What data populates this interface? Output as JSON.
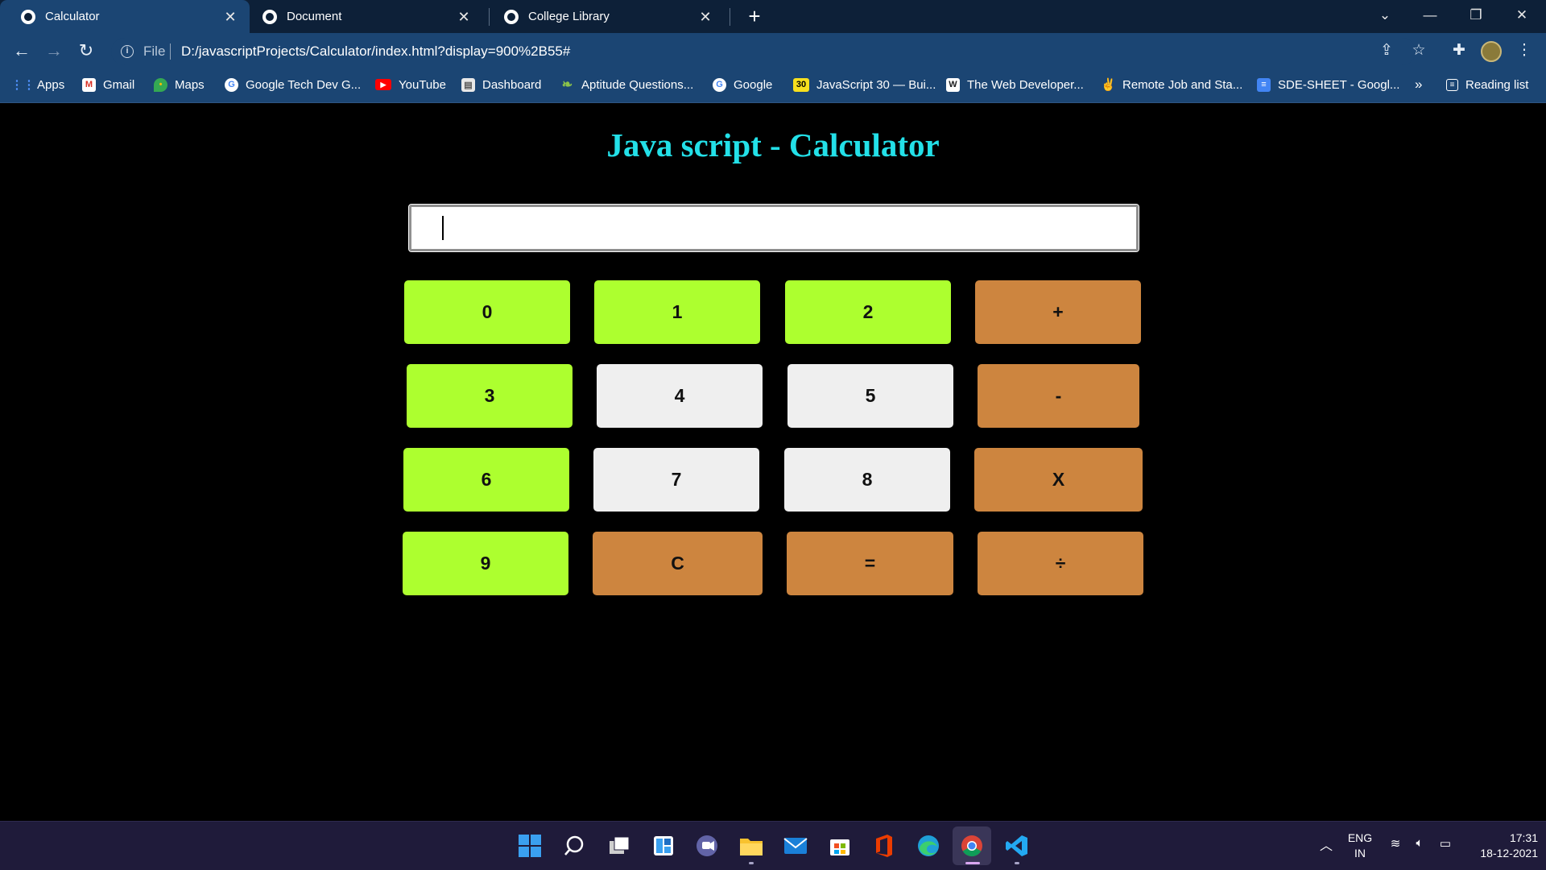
{
  "browser": {
    "tabs": [
      {
        "label": "Calculator",
        "active": true
      },
      {
        "label": "Document",
        "active": false
      },
      {
        "label": "College Library",
        "active": false
      }
    ],
    "url_scheme": "File",
    "url": "D:/javascriptProjects/Calculator/index.html?display=900%2B55#",
    "bookmarks": [
      {
        "label": "Apps",
        "icon": "apps-grid-icon"
      },
      {
        "label": "Gmail",
        "icon": "gmail-icon"
      },
      {
        "label": "Maps",
        "icon": "maps-icon"
      },
      {
        "label": "Google Tech Dev G...",
        "icon": "google-icon"
      },
      {
        "label": "YouTube",
        "icon": "youtube-icon"
      },
      {
        "label": "Dashboard",
        "icon": "dashboard-icon"
      },
      {
        "label": "Aptitude Questions...",
        "icon": "leaf-icon"
      },
      {
        "label": "Google",
        "icon": "google-icon"
      },
      {
        "label": "JavaScript 30 — Bui...",
        "icon": "js30-icon"
      },
      {
        "label": "The Web Developer...",
        "icon": "webdev-icon"
      },
      {
        "label": "Remote Job and Sta...",
        "icon": "remote-icon"
      },
      {
        "label": "SDE-SHEET - Googl...",
        "icon": "docs-icon"
      }
    ],
    "overflow": "»",
    "reading_list": "Reading list",
    "js30_badge": "30"
  },
  "page": {
    "title": "Java script - Calculator",
    "display_value": "",
    "keys": [
      {
        "label": "0",
        "color": "green"
      },
      {
        "label": "1",
        "color": "green"
      },
      {
        "label": "2",
        "color": "green"
      },
      {
        "label": "+",
        "color": "orange"
      },
      {
        "label": "3",
        "color": "green"
      },
      {
        "label": "4",
        "color": "white"
      },
      {
        "label": "5",
        "color": "white"
      },
      {
        "label": "-",
        "color": "orange"
      },
      {
        "label": "6",
        "color": "green"
      },
      {
        "label": "7",
        "color": "white"
      },
      {
        "label": "8",
        "color": "white"
      },
      {
        "label": "X",
        "color": "orange"
      },
      {
        "label": "9",
        "color": "green"
      },
      {
        "label": "C",
        "color": "orange"
      },
      {
        "label": "=",
        "color": "orange"
      },
      {
        "label": "÷",
        "color": "orange"
      }
    ]
  },
  "taskbar": {
    "lang_line1": "ENG",
    "lang_line2": "IN",
    "time": "17:31",
    "date": "18-12-2021"
  },
  "colors": {
    "title": "#23e0e8",
    "key_green": "#adff2f",
    "key_white": "#efefef",
    "key_orange": "#cd853f"
  }
}
